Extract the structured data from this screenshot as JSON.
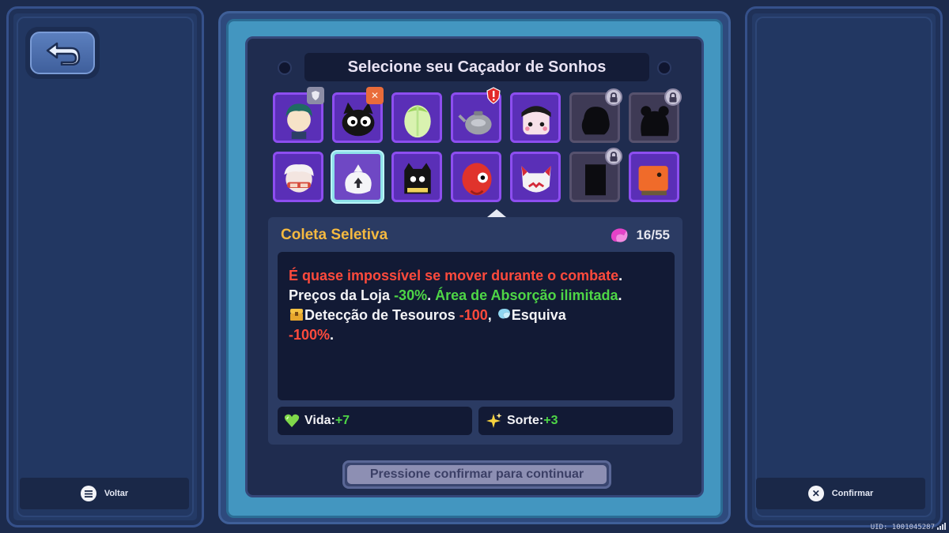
{
  "screen": {
    "title": "Selecione seu Caçador de Sonhos",
    "uid": "UID: 1001045287"
  },
  "hints": {
    "back_label": "Voltar",
    "back_icon": "menu-icon",
    "confirm_label": "Confirmar",
    "confirm_icon": "close-icon"
  },
  "hunters": [
    {
      "name": "green-haired-hunter",
      "locked": false,
      "selected": false,
      "badge": "shield"
    },
    {
      "name": "black-cat-hunter",
      "locked": false,
      "selected": false,
      "badge": "cross"
    },
    {
      "name": "cabbage-hunter",
      "locked": false,
      "selected": false,
      "badge": null
    },
    {
      "name": "teapot-hunter",
      "locked": false,
      "selected": false,
      "badge": "alert"
    },
    {
      "name": "pink-face-hunter",
      "locked": false,
      "selected": false,
      "badge": null
    },
    {
      "name": "locked-hunter-1",
      "locked": true,
      "selected": false,
      "badge": null
    },
    {
      "name": "locked-hunter-2",
      "locked": true,
      "selected": false,
      "badge": null
    },
    {
      "name": "old-man-hunter",
      "locked": false,
      "selected": false,
      "badge": null
    },
    {
      "name": "trash-bag-hunter",
      "locked": false,
      "selected": true,
      "badge": null
    },
    {
      "name": "black-cat-box-hunter",
      "locked": false,
      "selected": false,
      "badge": null
    },
    {
      "name": "red-helmet-hunter",
      "locked": false,
      "selected": false,
      "badge": null
    },
    {
      "name": "fox-mask-hunter",
      "locked": false,
      "selected": false,
      "badge": null
    },
    {
      "name": "locked-hunter-3",
      "locked": true,
      "selected": false,
      "badge": null
    },
    {
      "name": "orange-box-hunter",
      "locked": false,
      "selected": false,
      "badge": null
    }
  ],
  "selected": {
    "name": "Coleta Seletiva",
    "count": "16/55",
    "description": {
      "line1_red": "É quase impossível se mover durante o combate",
      "dot1": ".",
      "shop_label": "Preços da Loja ",
      "shop_value": "-30%",
      "dot2": ". ",
      "area_green": "Área de Absorção ilimitada",
      "dot3": ".",
      "treasure_label": "Detecção de Tesouros ",
      "treasure_value": "-100",
      "comma": ", ",
      "dodge_label": "Esquiva ",
      "dodge_value": "-100%",
      "dot4": "."
    },
    "stats": [
      {
        "label": "Vida: ",
        "value": "+7",
        "icon": "heart-icon"
      },
      {
        "label": "Sorte: ",
        "value": "+3",
        "icon": "sparkle-icon"
      }
    ]
  },
  "confirm_prompt": "Pressione confirmar para continuar",
  "colors": {
    "accent_purple": "#8d4ef0",
    "title_gold": "#f5b940",
    "negative_red": "#ff4a3c",
    "positive_green": "#4ed646"
  }
}
